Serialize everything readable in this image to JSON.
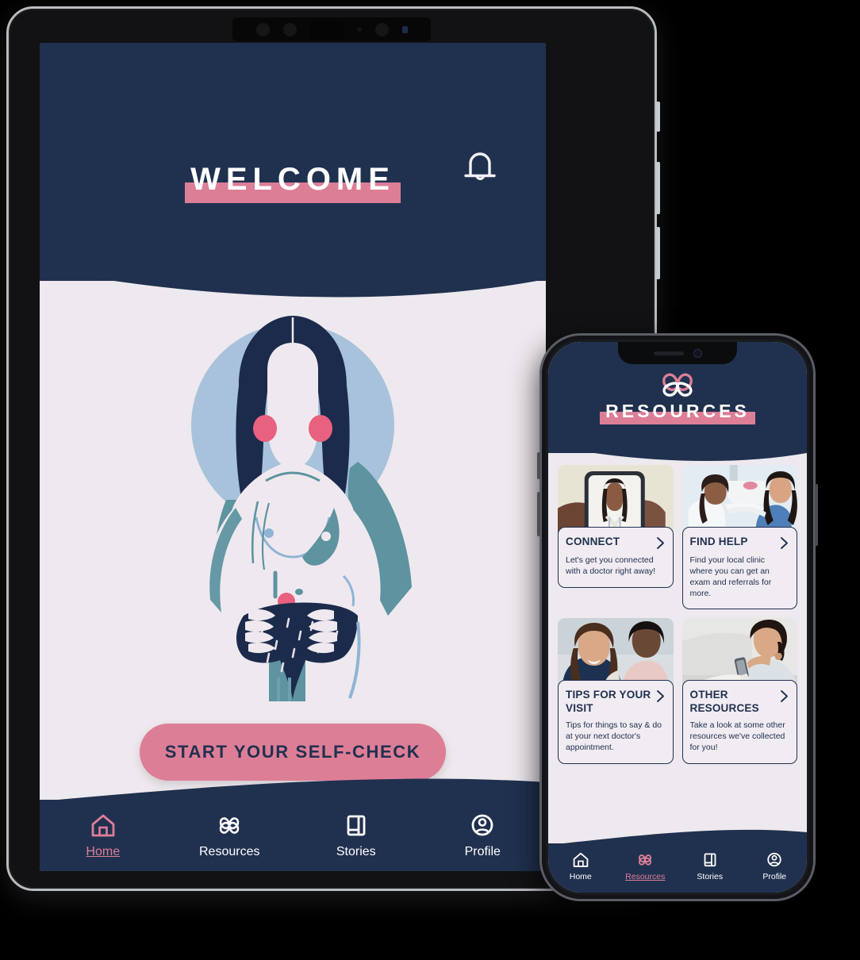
{
  "colors": {
    "navy": "#20314F",
    "pink": "#DD7E97",
    "background": "#EEE9EE",
    "card_surface": "#F1ECF2",
    "halo_blue": "#A8C2DC",
    "teal": "#5E93A0",
    "skin": "#EFE9EF"
  },
  "tablet": {
    "header": {
      "title": "WELCOME",
      "bell_icon": "bell-icon"
    },
    "illustration": {
      "name": "self-check-illustration",
      "description": "Woman performing a breast self-check"
    },
    "cta": {
      "label": "START YOUR SELF-CHECK"
    },
    "nav": {
      "items": [
        {
          "label": "Home",
          "icon": "home-icon",
          "active": true
        },
        {
          "label": "Resources",
          "icon": "hearts-icon",
          "active": false
        },
        {
          "label": "Stories",
          "icon": "book-icon",
          "active": false
        },
        {
          "label": "Profile",
          "icon": "profile-icon",
          "active": false
        }
      ]
    }
  },
  "phone": {
    "header": {
      "logo_icon": "hearts-logo-icon",
      "title": "RESOURCES"
    },
    "cards": [
      {
        "title": "CONNECT",
        "desc": "Let's get you connected with a doctor right away!",
        "chevron_icon": "chevron-right-icon",
        "photo": "telehealth-doctor-on-phone-photo"
      },
      {
        "title": "FIND HELP",
        "desc": "Find your local clinic where you can get an exam and referrals for more.",
        "chevron_icon": "chevron-right-icon",
        "photo": "clinic-mammogram-photo"
      },
      {
        "title": "TIPS FOR YOUR VISIT",
        "desc": "Tips for things to say & do at your next doctor's appointment.",
        "chevron_icon": "chevron-right-icon",
        "photo": "patient-talking-with-provider-photo"
      },
      {
        "title": "OTHER RESOURCES",
        "desc": "Take a look at some other resources we've collected for you!",
        "chevron_icon": "chevron-right-icon",
        "photo": "woman-on-couch-with-phone-photo"
      }
    ],
    "nav": {
      "items": [
        {
          "label": "Home",
          "icon": "home-icon",
          "active": false
        },
        {
          "label": "Resources",
          "icon": "hearts-icon",
          "active": true
        },
        {
          "label": "Stories",
          "icon": "book-icon",
          "active": false
        },
        {
          "label": "Profile",
          "icon": "profile-icon",
          "active": false
        }
      ]
    }
  }
}
